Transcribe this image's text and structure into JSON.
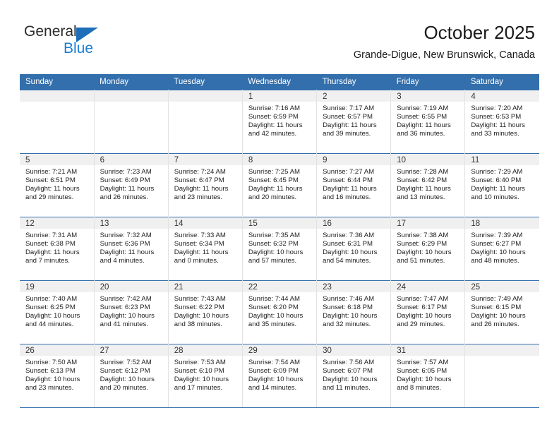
{
  "brand": {
    "name_top": "General",
    "name_bottom": "Blue",
    "triangle_color": "#1e6eb8",
    "blue_text_color": "#1b7fd4"
  },
  "header": {
    "month_title": "October 2025",
    "location": "Grande-Digue, New Brunswick, Canada",
    "header_bg_color": "#336fac",
    "daynum_bg_color": "#f0f0f0"
  },
  "weekday_headers": [
    "Sunday",
    "Monday",
    "Tuesday",
    "Wednesday",
    "Thursday",
    "Friday",
    "Saturday"
  ],
  "weeks": [
    [
      {
        "day": "",
        "lines": []
      },
      {
        "day": "",
        "lines": []
      },
      {
        "day": "",
        "lines": []
      },
      {
        "day": "1",
        "lines": [
          "Sunrise: 7:16 AM",
          "Sunset: 6:59 PM",
          "Daylight: 11 hours",
          "and 42 minutes."
        ]
      },
      {
        "day": "2",
        "lines": [
          "Sunrise: 7:17 AM",
          "Sunset: 6:57 PM",
          "Daylight: 11 hours",
          "and 39 minutes."
        ]
      },
      {
        "day": "3",
        "lines": [
          "Sunrise: 7:19 AM",
          "Sunset: 6:55 PM",
          "Daylight: 11 hours",
          "and 36 minutes."
        ]
      },
      {
        "day": "4",
        "lines": [
          "Sunrise: 7:20 AM",
          "Sunset: 6:53 PM",
          "Daylight: 11 hours",
          "and 33 minutes."
        ]
      }
    ],
    [
      {
        "day": "5",
        "lines": [
          "Sunrise: 7:21 AM",
          "Sunset: 6:51 PM",
          "Daylight: 11 hours",
          "and 29 minutes."
        ]
      },
      {
        "day": "6",
        "lines": [
          "Sunrise: 7:23 AM",
          "Sunset: 6:49 PM",
          "Daylight: 11 hours",
          "and 26 minutes."
        ]
      },
      {
        "day": "7",
        "lines": [
          "Sunrise: 7:24 AM",
          "Sunset: 6:47 PM",
          "Daylight: 11 hours",
          "and 23 minutes."
        ]
      },
      {
        "day": "8",
        "lines": [
          "Sunrise: 7:25 AM",
          "Sunset: 6:45 PM",
          "Daylight: 11 hours",
          "and 20 minutes."
        ]
      },
      {
        "day": "9",
        "lines": [
          "Sunrise: 7:27 AM",
          "Sunset: 6:44 PM",
          "Daylight: 11 hours",
          "and 16 minutes."
        ]
      },
      {
        "day": "10",
        "lines": [
          "Sunrise: 7:28 AM",
          "Sunset: 6:42 PM",
          "Daylight: 11 hours",
          "and 13 minutes."
        ]
      },
      {
        "day": "11",
        "lines": [
          "Sunrise: 7:29 AM",
          "Sunset: 6:40 PM",
          "Daylight: 11 hours",
          "and 10 minutes."
        ]
      }
    ],
    [
      {
        "day": "12",
        "lines": [
          "Sunrise: 7:31 AM",
          "Sunset: 6:38 PM",
          "Daylight: 11 hours",
          "and 7 minutes."
        ]
      },
      {
        "day": "13",
        "lines": [
          "Sunrise: 7:32 AM",
          "Sunset: 6:36 PM",
          "Daylight: 11 hours",
          "and 4 minutes."
        ]
      },
      {
        "day": "14",
        "lines": [
          "Sunrise: 7:33 AM",
          "Sunset: 6:34 PM",
          "Daylight: 11 hours",
          "and 0 minutes."
        ]
      },
      {
        "day": "15",
        "lines": [
          "Sunrise: 7:35 AM",
          "Sunset: 6:32 PM",
          "Daylight: 10 hours",
          "and 57 minutes."
        ]
      },
      {
        "day": "16",
        "lines": [
          "Sunrise: 7:36 AM",
          "Sunset: 6:31 PM",
          "Daylight: 10 hours",
          "and 54 minutes."
        ]
      },
      {
        "day": "17",
        "lines": [
          "Sunrise: 7:38 AM",
          "Sunset: 6:29 PM",
          "Daylight: 10 hours",
          "and 51 minutes."
        ]
      },
      {
        "day": "18",
        "lines": [
          "Sunrise: 7:39 AM",
          "Sunset: 6:27 PM",
          "Daylight: 10 hours",
          "and 48 minutes."
        ]
      }
    ],
    [
      {
        "day": "19",
        "lines": [
          "Sunrise: 7:40 AM",
          "Sunset: 6:25 PM",
          "Daylight: 10 hours",
          "and 44 minutes."
        ]
      },
      {
        "day": "20",
        "lines": [
          "Sunrise: 7:42 AM",
          "Sunset: 6:23 PM",
          "Daylight: 10 hours",
          "and 41 minutes."
        ]
      },
      {
        "day": "21",
        "lines": [
          "Sunrise: 7:43 AM",
          "Sunset: 6:22 PM",
          "Daylight: 10 hours",
          "and 38 minutes."
        ]
      },
      {
        "day": "22",
        "lines": [
          "Sunrise: 7:44 AM",
          "Sunset: 6:20 PM",
          "Daylight: 10 hours",
          "and 35 minutes."
        ]
      },
      {
        "day": "23",
        "lines": [
          "Sunrise: 7:46 AM",
          "Sunset: 6:18 PM",
          "Daylight: 10 hours",
          "and 32 minutes."
        ]
      },
      {
        "day": "24",
        "lines": [
          "Sunrise: 7:47 AM",
          "Sunset: 6:17 PM",
          "Daylight: 10 hours",
          "and 29 minutes."
        ]
      },
      {
        "day": "25",
        "lines": [
          "Sunrise: 7:49 AM",
          "Sunset: 6:15 PM",
          "Daylight: 10 hours",
          "and 26 minutes."
        ]
      }
    ],
    [
      {
        "day": "26",
        "lines": [
          "Sunrise: 7:50 AM",
          "Sunset: 6:13 PM",
          "Daylight: 10 hours",
          "and 23 minutes."
        ]
      },
      {
        "day": "27",
        "lines": [
          "Sunrise: 7:52 AM",
          "Sunset: 6:12 PM",
          "Daylight: 10 hours",
          "and 20 minutes."
        ]
      },
      {
        "day": "28",
        "lines": [
          "Sunrise: 7:53 AM",
          "Sunset: 6:10 PM",
          "Daylight: 10 hours",
          "and 17 minutes."
        ]
      },
      {
        "day": "29",
        "lines": [
          "Sunrise: 7:54 AM",
          "Sunset: 6:09 PM",
          "Daylight: 10 hours",
          "and 14 minutes."
        ]
      },
      {
        "day": "30",
        "lines": [
          "Sunrise: 7:56 AM",
          "Sunset: 6:07 PM",
          "Daylight: 10 hours",
          "and 11 minutes."
        ]
      },
      {
        "day": "31",
        "lines": [
          "Sunrise: 7:57 AM",
          "Sunset: 6:05 PM",
          "Daylight: 10 hours",
          "and 8 minutes."
        ]
      },
      {
        "day": "",
        "lines": []
      }
    ]
  ]
}
